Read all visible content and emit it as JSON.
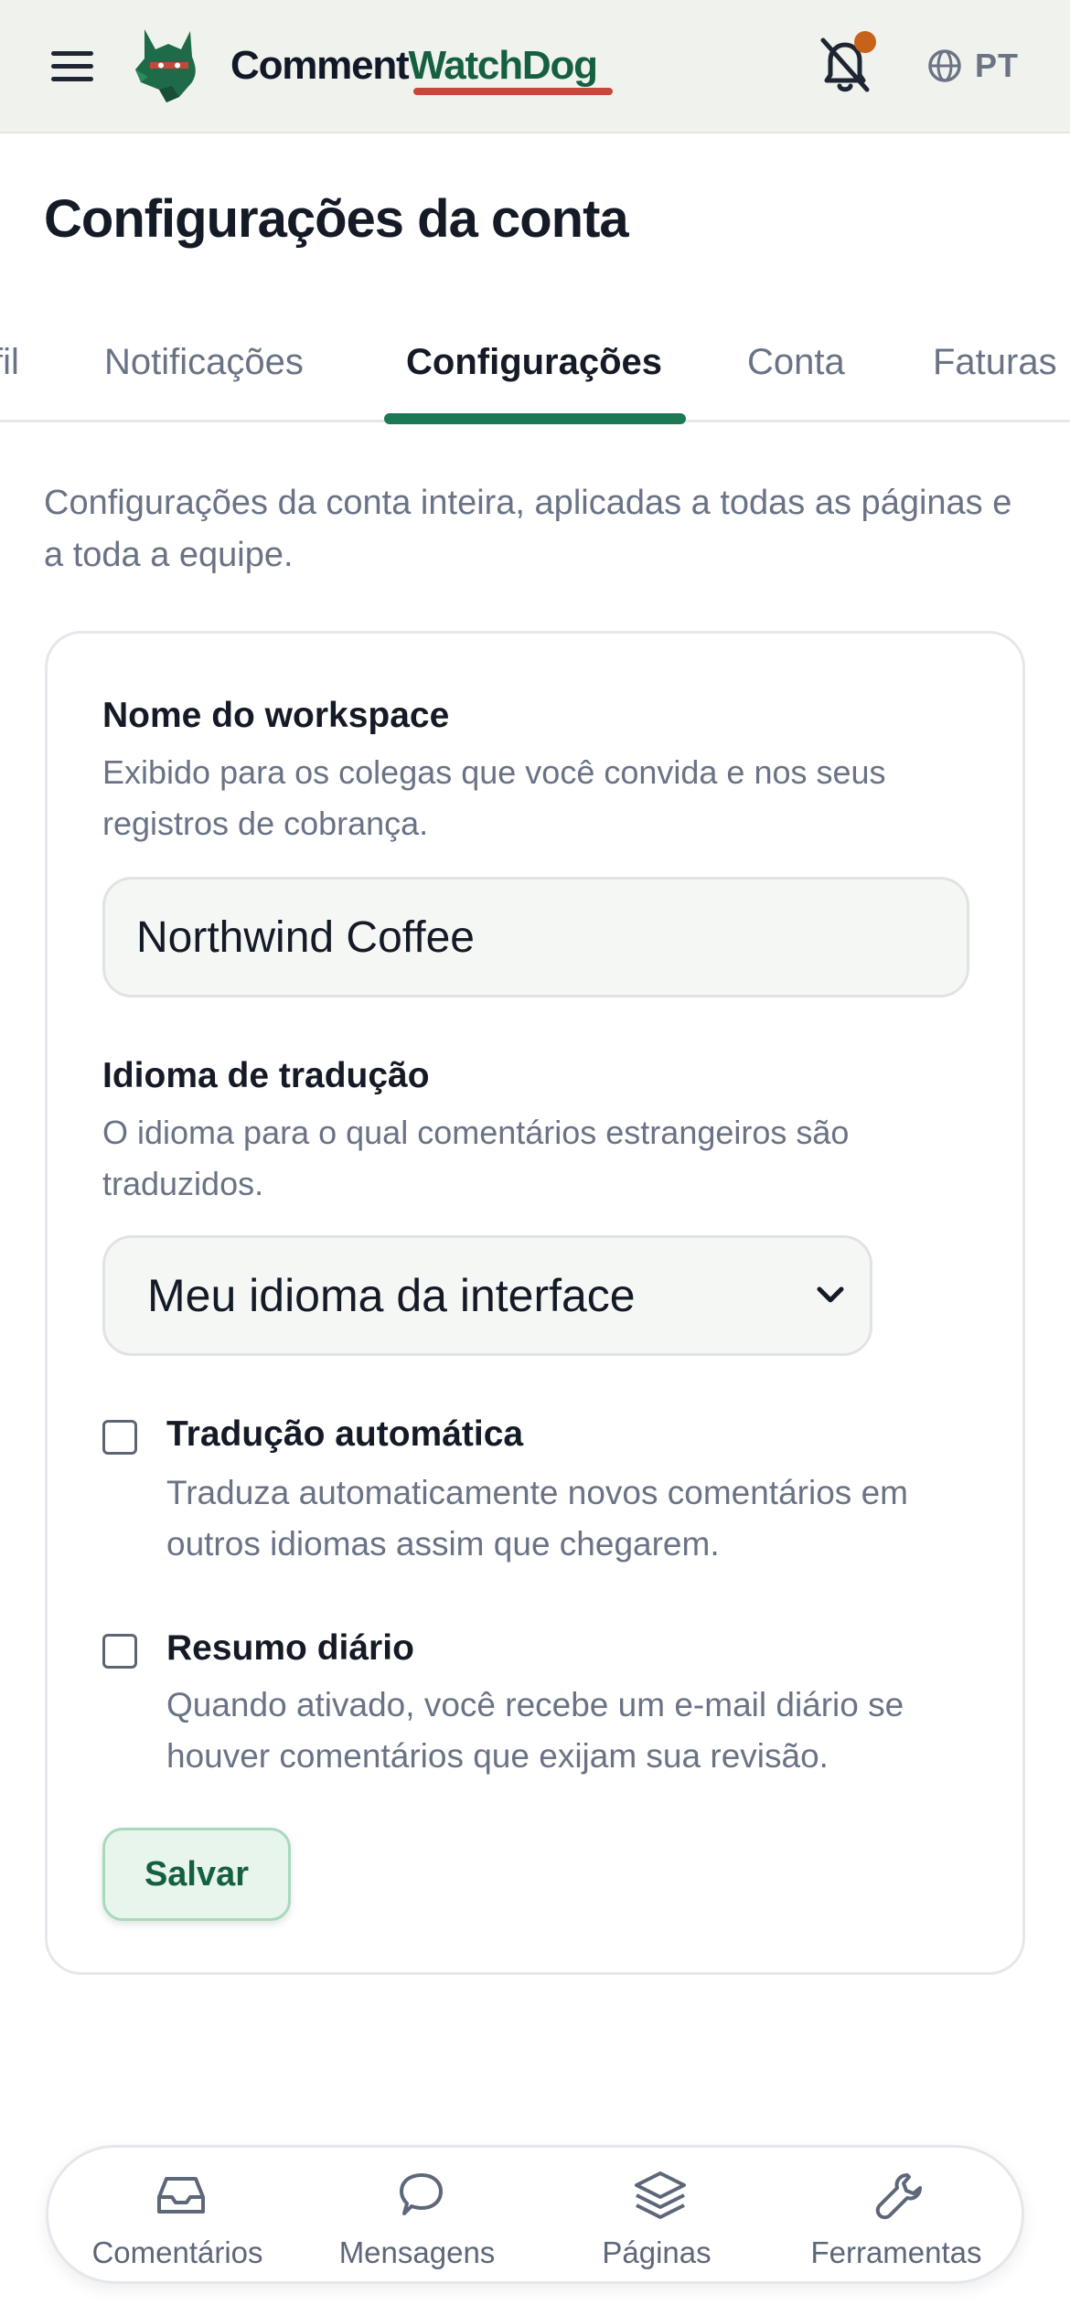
{
  "header": {
    "brand_part1": "Comment",
    "brand_part2": "WatchDog",
    "language_label": "PT",
    "colors": {
      "brand_dark": "#111827",
      "brand_green": "#15603f",
      "underline_red": "#c8473a",
      "notification_dot": "#c8621a"
    }
  },
  "page": {
    "title": "Configurações da conta",
    "tabs": [
      {
        "label": "fil"
      },
      {
        "label": "Notificações"
      },
      {
        "label": "Configurações",
        "active": true
      },
      {
        "label": "Conta"
      },
      {
        "label": "Faturas"
      }
    ],
    "intro": "Configurações da conta inteira, aplicadas a todas as páginas e a toda a equipe."
  },
  "form": {
    "workspace": {
      "label": "Nome do workspace",
      "help": "Exibido para os colegas que você convida e nos seus registros de cobrança.",
      "value": "Northwind Coffee"
    },
    "translation": {
      "label": "Idioma de tradução",
      "help": "O idioma para o qual comentários estrangeiros são traduzidos.",
      "selected": "Meu idioma da interface"
    },
    "auto_translate": {
      "label": "Tradução automática",
      "help": "Traduza automaticamente novos comentários em outros idiomas assim que chegarem.",
      "checked": false
    },
    "daily_digest": {
      "label": "Resumo diário",
      "help": "Quando ativado, você recebe um e-mail diário se houver comentários que exijam sua revisão.",
      "checked": false
    },
    "save_label": "Salvar"
  },
  "bottom_nav": {
    "items": [
      {
        "label": "Comentários",
        "icon": "inbox-icon"
      },
      {
        "label": "Mensagens",
        "icon": "chat-bubble-icon"
      },
      {
        "label": "Páginas",
        "icon": "layers-icon"
      },
      {
        "label": "Ferramentas",
        "icon": "wrench-icon"
      }
    ]
  },
  "colors": {
    "accent": "#1b7a54",
    "muted_text": "#6a7385"
  }
}
